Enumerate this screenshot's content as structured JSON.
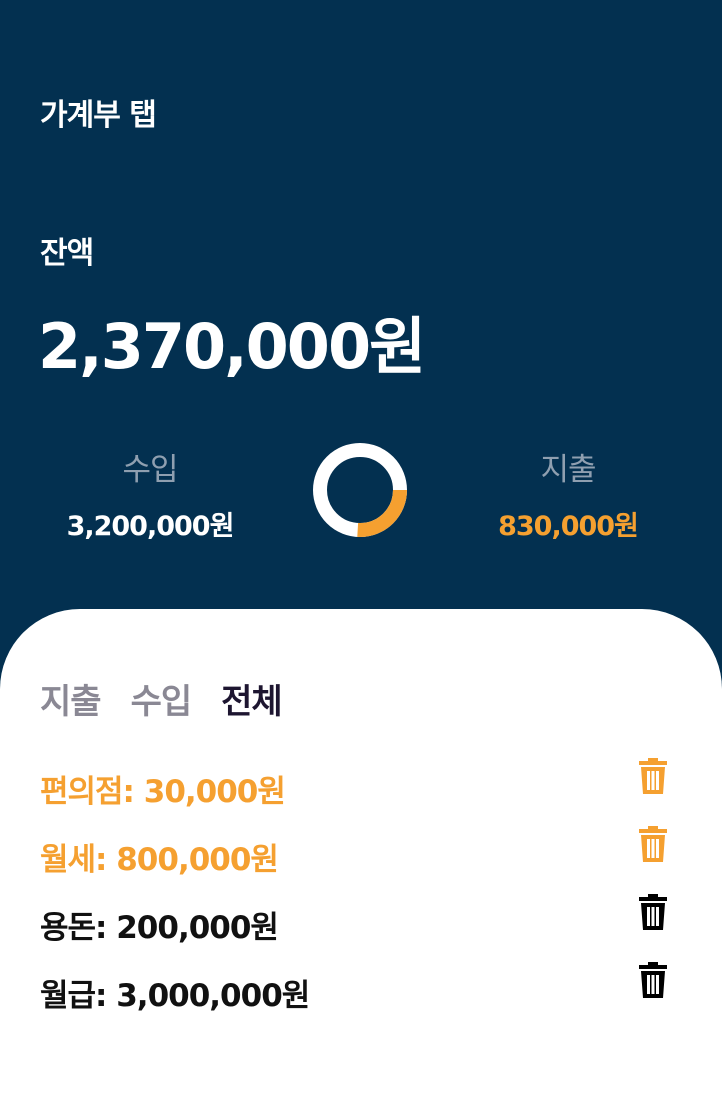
{
  "header": {
    "app_title": "가계부 탭",
    "balance_label": "잔액",
    "balance_amount": "2,370,000원"
  },
  "summary": {
    "income_label": "수입",
    "income_value": "3,200,000원",
    "expense_label": "지출",
    "expense_value": "830,000원",
    "expense_ratio": 0.259
  },
  "tabs": [
    {
      "label": "지출",
      "active": false
    },
    {
      "label": "수입",
      "active": false
    },
    {
      "label": "전체",
      "active": true
    }
  ],
  "transactions": [
    {
      "text": "편의점: 30,000원",
      "type": "expense",
      "icon": "trash-icon"
    },
    {
      "text": "월세: 800,000원",
      "type": "expense",
      "icon": "trash-icon"
    },
    {
      "text": "용돈: 200,000원",
      "type": "income",
      "icon": "trash-icon"
    },
    {
      "text": "월급: 3,000,000원",
      "type": "income",
      "icon": "trash-icon"
    }
  ],
  "colors": {
    "background": "#033050",
    "accent": "#f5a030",
    "card": "#ffffff"
  }
}
